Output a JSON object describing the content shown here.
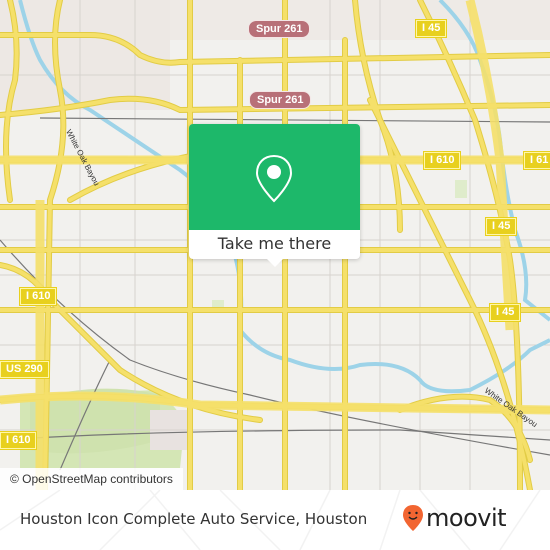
{
  "map": {
    "shields": {
      "spur_1": "Spur 261",
      "spur_2": "Spur 261",
      "i45_top": "I 45",
      "i610_center": "I 610",
      "i610_right": "I 61",
      "i45_mid": "I 45",
      "i45_low": "I 45",
      "i610_left": "I 610",
      "us290": "US 290",
      "i610_bottom_left": "I 610"
    },
    "street_labels": {
      "white_oak_left": "White Oak Bayou",
      "white_oak_right": "White Oak Bayou"
    },
    "attribution": "© OpenStreetMap contributors",
    "colors": {
      "land": "#f2f1ee",
      "road": "#f5e06a",
      "water": "#9dd3e8",
      "park": "#d4e6b5",
      "rail": "#777777"
    }
  },
  "popup": {
    "icon": "location-pin-icon",
    "button_label": "Take me there",
    "color": "#1db86a"
  },
  "footer": {
    "title": "Houston Icon Complete Auto Service, Houston",
    "brand": "moovit",
    "brand_color": "#f26531"
  }
}
